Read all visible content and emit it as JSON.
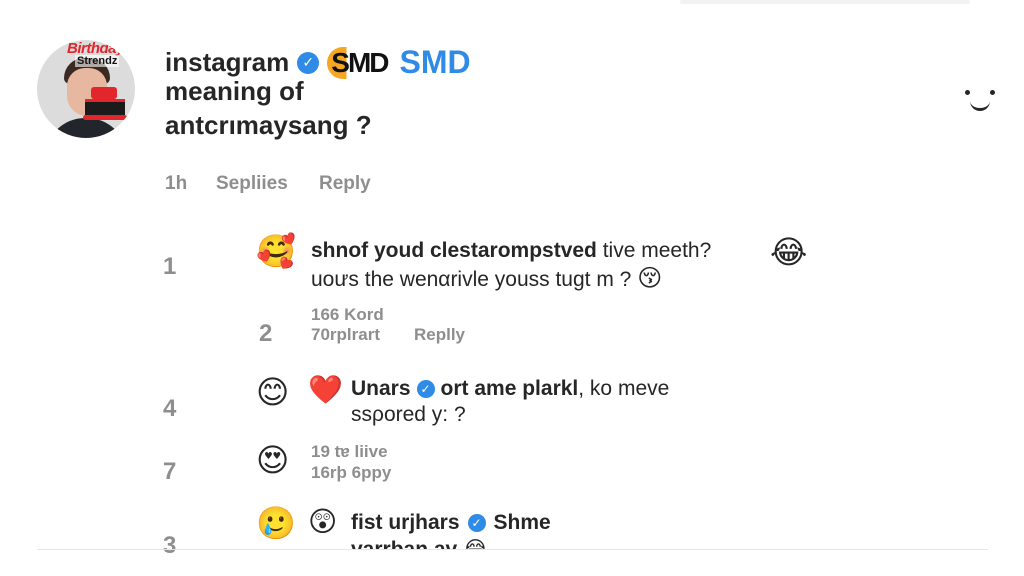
{
  "post": {
    "avatar": {
      "logo_line1": "Birthday",
      "logo_line2": "Strendz"
    },
    "username": "instagram",
    "logo_text": "SMD",
    "brand_text": "SMD",
    "line2": "meaning of",
    "line3": "antcrımaysang ?",
    "time": "1h",
    "replies_label": "Sepliies",
    "reply_label": "Reply"
  },
  "comments": [
    {
      "number": "1",
      "emoji": "🥰",
      "text_bold": "shnof youd clestarompstved",
      "text_rest": " tive meeth?",
      "line2": "uoưs the wenαrivle  youss tugt m ?",
      "line2_emoji": "😚",
      "side_emoji": "😂"
    },
    {
      "number": "2",
      "meta_line1": "166  Kord",
      "meta_line2": "70rplrart",
      "reply_label": "Replly"
    },
    {
      "number": "4",
      "emoji": "😊",
      "emoji2": "❤️",
      "text_bold": "Unars",
      "text_bold2": "ort ame plarkl",
      "text_rest": ",  ko meve",
      "line2": "ssρored y: ?"
    },
    {
      "number": "7",
      "emoji": "😍",
      "meta_line1": "19 tɐ liive",
      "meta_line2": "16rþ 6ppy"
    },
    {
      "number": "3",
      "emoji": "🥲",
      "emoji2": "😲",
      "text_bold": "fist urjhars",
      "text_rest": "Shme",
      "line2": "varrban av",
      "line2_emoji": "😂"
    }
  ]
}
